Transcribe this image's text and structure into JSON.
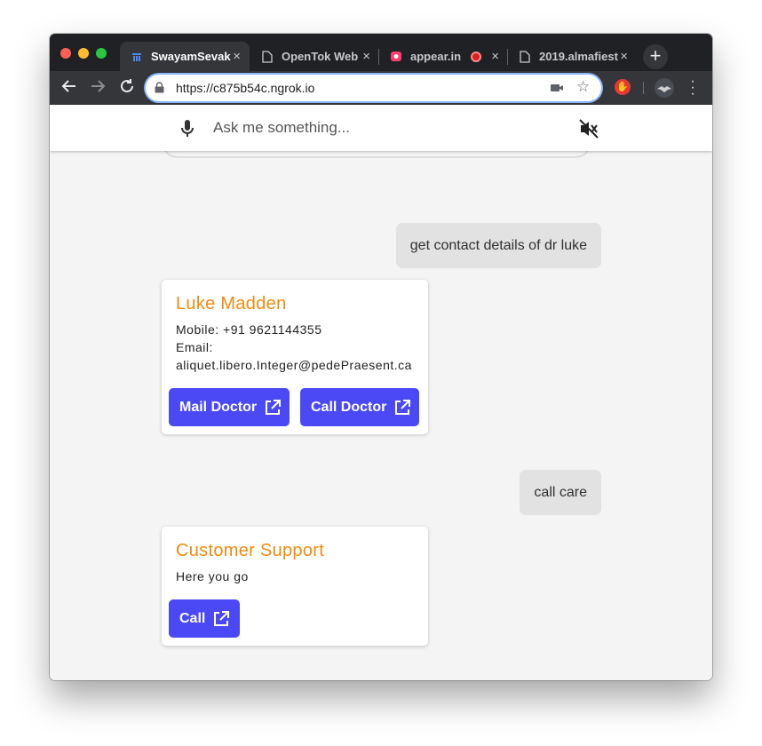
{
  "browser": {
    "tabs": [
      {
        "title": "SwayamSevak",
        "active": true,
        "icon": "app-favicon-icon"
      },
      {
        "title": "OpenTok Web",
        "active": false,
        "icon": "document-icon"
      },
      {
        "title": "appear.in",
        "active": false,
        "icon": "appear-favicon-icon"
      },
      {
        "title": "2019.almafiest",
        "active": false,
        "icon": "document-icon"
      }
    ],
    "new_tab": "+",
    "close_glyph": "×",
    "url": "https://c875b54c.ngrok.io"
  },
  "assistant": {
    "input_placeholder": "Ask me something..."
  },
  "conversation": {
    "user_msg_1": "get contact details of dr luke",
    "contact_card": {
      "name": "Luke Madden",
      "mobile": "Mobile: +91 9621144355",
      "email_label": "Email:",
      "email": "aliquet.libero.Integer@pedePraesent.ca",
      "mail_button": "Mail Doctor",
      "call_button": "Call Doctor"
    },
    "user_msg_2": "call care",
    "support_card": {
      "title": "Customer Support",
      "text": "Here you go",
      "call_button": "Call"
    }
  },
  "colors": {
    "accent_button": "#4a49f5",
    "card_title": "#f08b0f",
    "user_bubble": "#e2e2e2"
  }
}
